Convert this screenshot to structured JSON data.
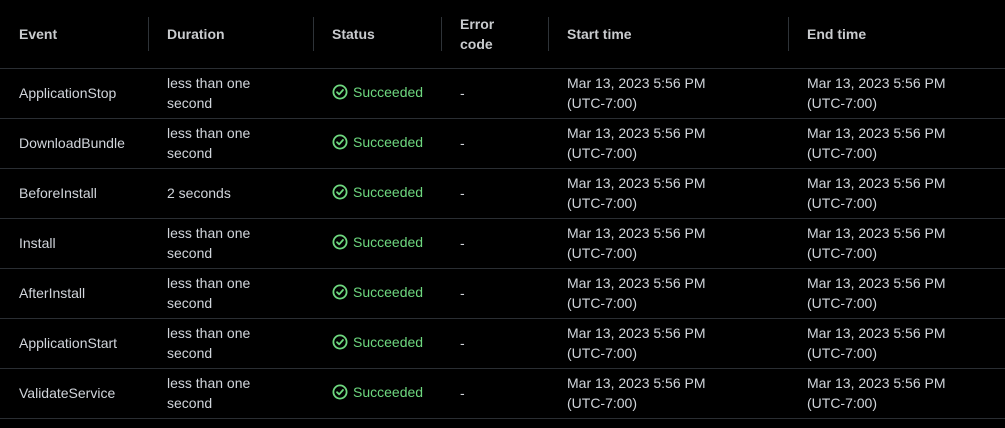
{
  "columns": {
    "event": "Event",
    "duration": "Duration",
    "status": "Status",
    "error_code": "Error\ncode",
    "start_time": "Start time",
    "end_time": "End time"
  },
  "status_icon": "check-circle-icon",
  "colors": {
    "background": "#000000",
    "success": "#6ed87f",
    "text": "#d1d5db",
    "header_text": "#c9cbce",
    "row_border": "#2a2e33"
  },
  "rows": [
    {
      "event": "ApplicationStop",
      "duration": "less than one second",
      "status": "Succeeded",
      "error_code": "-",
      "start_date": "Mar 13, 2023 5:56 PM",
      "start_tz": "(UTC-7:00)",
      "end_date": "Mar 13, 2023 5:56 PM",
      "end_tz": "(UTC-7:00)"
    },
    {
      "event": "DownloadBundle",
      "duration": "less than one second",
      "status": "Succeeded",
      "error_code": "-",
      "start_date": "Mar 13, 2023 5:56 PM",
      "start_tz": "(UTC-7:00)",
      "end_date": "Mar 13, 2023 5:56 PM",
      "end_tz": "(UTC-7:00)"
    },
    {
      "event": "BeforeInstall",
      "duration": "2 seconds",
      "status": "Succeeded",
      "error_code": "-",
      "start_date": "Mar 13, 2023 5:56 PM",
      "start_tz": "(UTC-7:00)",
      "end_date": "Mar 13, 2023 5:56 PM",
      "end_tz": "(UTC-7:00)"
    },
    {
      "event": "Install",
      "duration": "less than one second",
      "status": "Succeeded",
      "error_code": "-",
      "start_date": "Mar 13, 2023 5:56 PM",
      "start_tz": "(UTC-7:00)",
      "end_date": "Mar 13, 2023 5:56 PM",
      "end_tz": "(UTC-7:00)"
    },
    {
      "event": "AfterInstall",
      "duration": "less than one second",
      "status": "Succeeded",
      "error_code": "-",
      "start_date": "Mar 13, 2023 5:56 PM",
      "start_tz": "(UTC-7:00)",
      "end_date": "Mar 13, 2023 5:56 PM",
      "end_tz": "(UTC-7:00)"
    },
    {
      "event": "ApplicationStart",
      "duration": "less than one second",
      "status": "Succeeded",
      "error_code": "-",
      "start_date": "Mar 13, 2023 5:56 PM",
      "start_tz": "(UTC-7:00)",
      "end_date": "Mar 13, 2023 5:56 PM",
      "end_tz": "(UTC-7:00)"
    },
    {
      "event": "ValidateService",
      "duration": "less than one second",
      "status": "Succeeded",
      "error_code": "-",
      "start_date": "Mar 13, 2023 5:56 PM",
      "start_tz": "(UTC-7:00)",
      "end_date": "Mar 13, 2023 5:56 PM",
      "end_tz": "(UTC-7:00)"
    }
  ]
}
